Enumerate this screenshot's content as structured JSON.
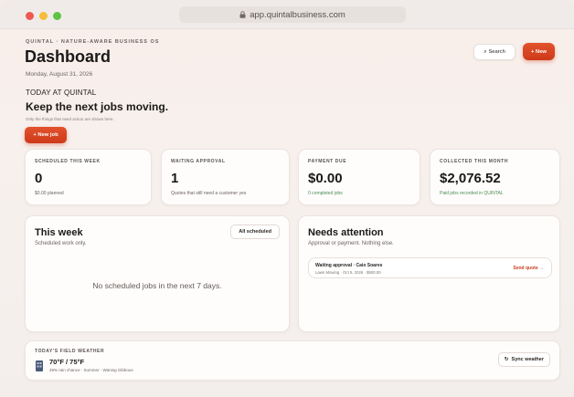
{
  "browser": {
    "url": "app.quintalbusiness.com"
  },
  "header": {
    "eyebrow": "QUINTAL · NATURE-AWARE BUSINESS OS",
    "title": "Dashboard",
    "date": "Monday, August 31, 2026",
    "search_label": "Search",
    "search_icon": "⌕",
    "new_label": "+ New"
  },
  "intro": {
    "today": "TODAY AT QUINTAL",
    "headline": "Keep the next jobs moving.",
    "sub": "Only the things that need action are shown here.",
    "new_job_label": "+ New job"
  },
  "stats": [
    {
      "label": "SCHEDULED THIS WEEK",
      "value": "0",
      "note": "$0.00 planned"
    },
    {
      "label": "WAITING APPROVAL",
      "value": "1",
      "note": "Quotes that still need a customer yes"
    },
    {
      "label": "PAYMENT DUE",
      "value": "$0.00",
      "note": "0 completed jobs"
    },
    {
      "label": "COLLECTED THIS MONTH",
      "value": "$2,076.52",
      "note": "Paid jobs recorded in QUINTAL"
    }
  ],
  "this_week": {
    "title": "This week",
    "sub": "Scheduled work only.",
    "button_label": "All scheduled",
    "empty_message": "No scheduled jobs in the next 7 days."
  },
  "needs_attention": {
    "title": "Needs attention",
    "sub": "Approval or payment. Nothing else.",
    "items": [
      {
        "title": "Waiting approval · Caio Soares",
        "meta": "Lawn Mowing · Oct 5, 2026 · $500.00",
        "action": "Send quote →"
      }
    ]
  },
  "weather": {
    "label": "TODAY'S FIELD WEATHER",
    "temp": "70°F / 75°F",
    "meta": "49% rain chance · Summer · Waning Gibbous",
    "sync_label": "Sync weather",
    "sync_icon": "↻"
  },
  "colors": {
    "accent": "#d8462a",
    "green": "#4b8b55"
  }
}
